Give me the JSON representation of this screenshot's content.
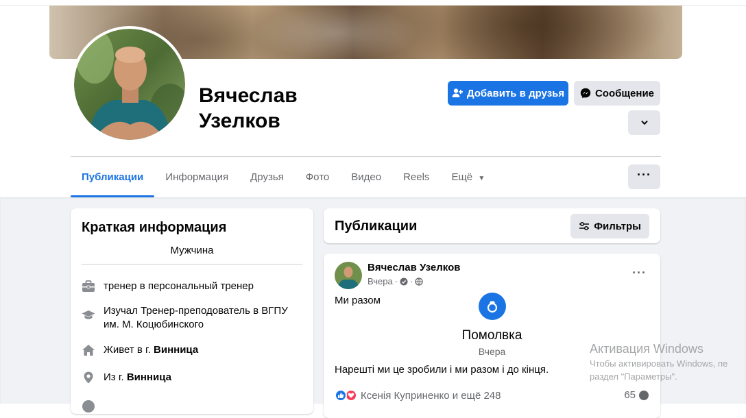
{
  "profile": {
    "name": "Вячеслав Узелков"
  },
  "actions": {
    "add_friend": "Добавить в друзья",
    "message": "Сообщение"
  },
  "tabs": [
    {
      "label": "Публикации",
      "active": true
    },
    {
      "label": "Информация"
    },
    {
      "label": "Друзья"
    },
    {
      "label": "Фото"
    },
    {
      "label": "Видео"
    },
    {
      "label": "Reels"
    },
    {
      "label": "Ещё"
    }
  ],
  "intro": {
    "title": "Краткая информация",
    "gender": "Мужчина",
    "work": "тренер в персональный тренер",
    "education": "Изучал Тренер-преподователь в ВГПУ им. М. Коцюбинского",
    "lives_prefix": "Живет в г. ",
    "lives_city": "Винница",
    "from_prefix": "Из г. ",
    "from_city": "Винница"
  },
  "posts_header": {
    "title": "Публикации",
    "filters": "Фильтры"
  },
  "post": {
    "author": "Вячеслав Узелков",
    "time": "Вчера",
    "separator": "·",
    "text": "Ми разом",
    "event_title": "Помолвка",
    "event_date": "Вчера",
    "body": "Нарешті ми це зробили і ми разом і до кінця.",
    "reactions_text": "Ксенія Куприненко и ещё 248",
    "comments_count": "65"
  },
  "watermark": {
    "line1": "Активация Windows",
    "line2": "Чтобы активировать Windows, пе",
    "line3": "раздел \"Параметры\"."
  },
  "colors": {
    "primary": "#1b74e4",
    "secondary_bg": "#e4e6eb",
    "page_bg": "#f0f2f5",
    "muted_text": "#65676b"
  }
}
